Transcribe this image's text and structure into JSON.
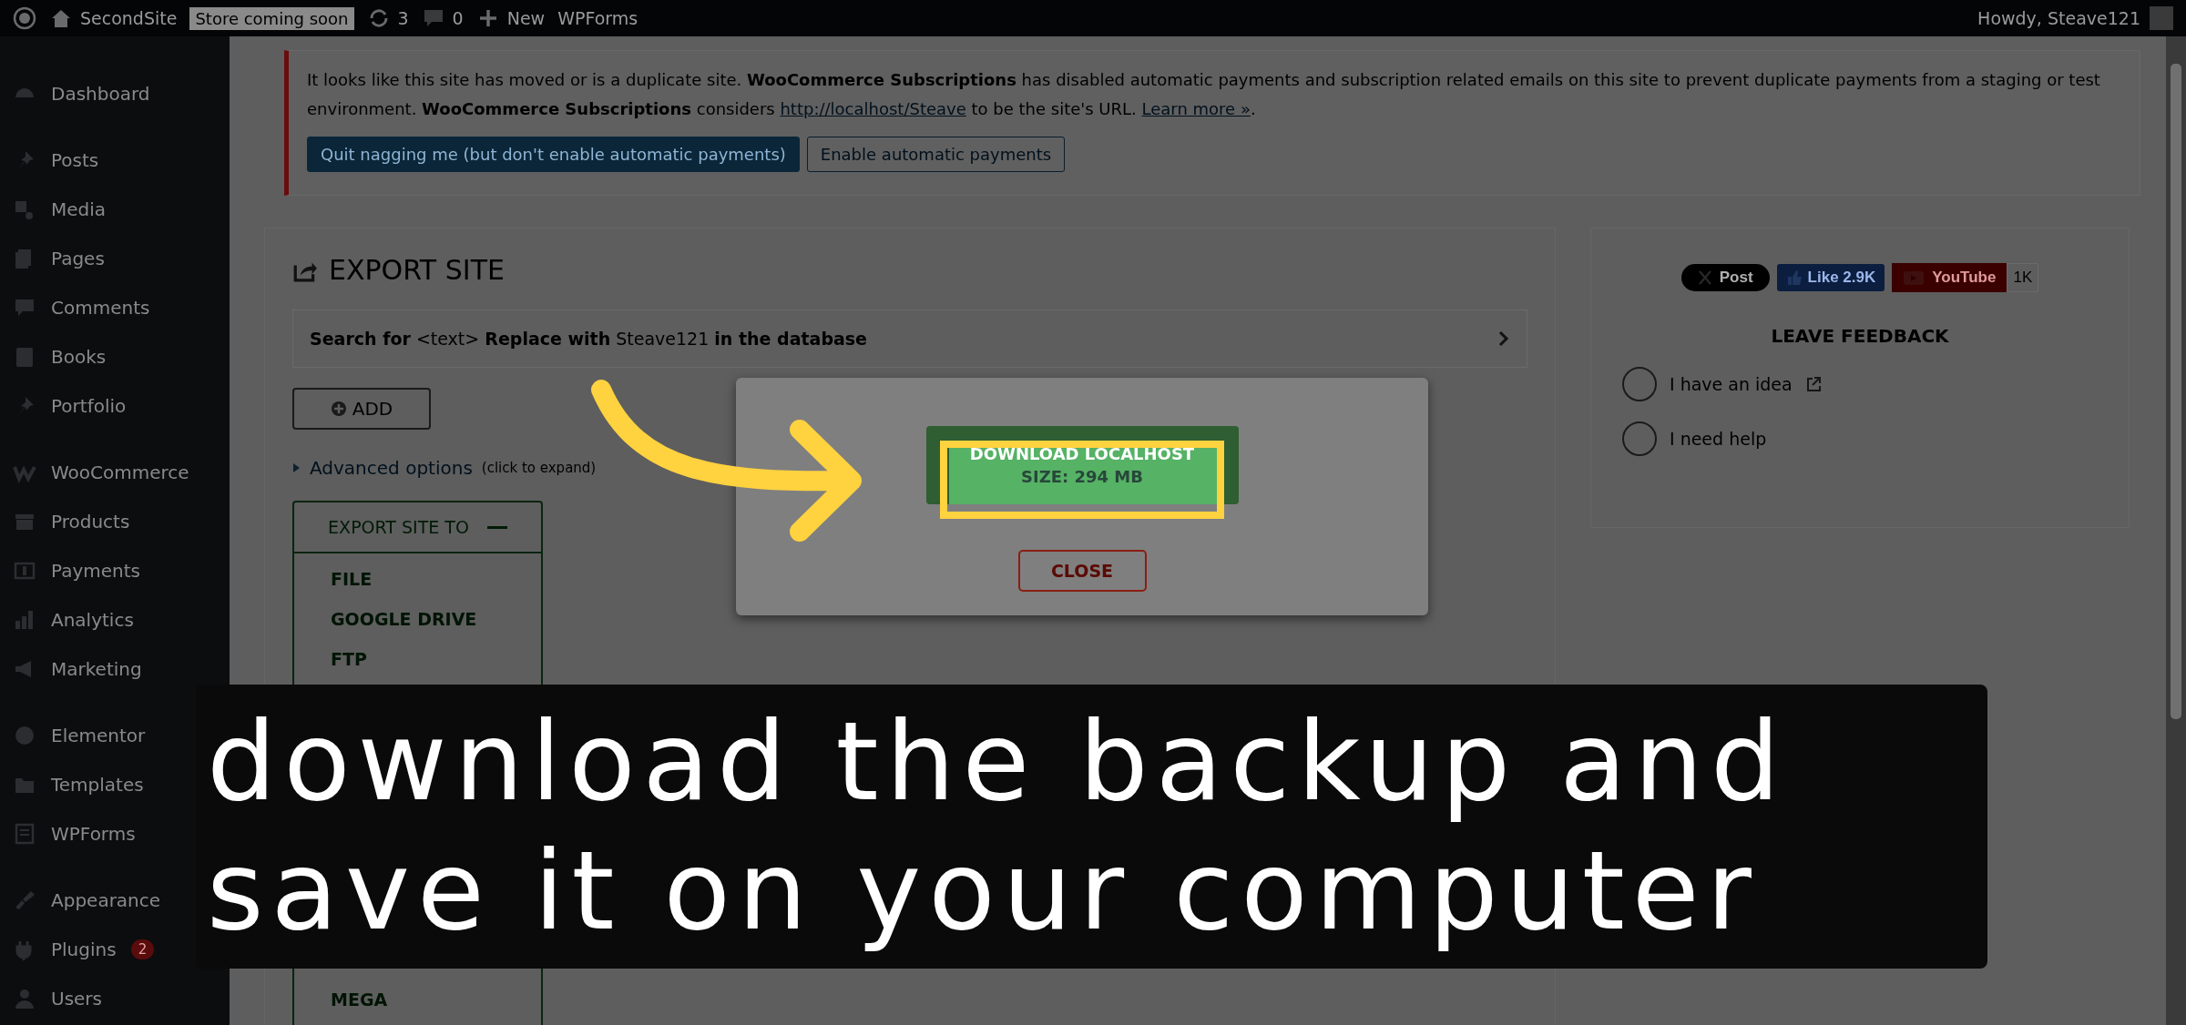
{
  "admin_bar": {
    "site_name": "SecondSite",
    "badge": "Store coming soon",
    "updates": "3",
    "comments": "0",
    "new": "New",
    "wpforms": "WPForms",
    "greeting": "Howdy, Steave121"
  },
  "sidebar": {
    "groups": [
      {
        "items": [
          {
            "label": "Dashboard"
          }
        ]
      },
      {
        "items": [
          {
            "label": "Posts"
          },
          {
            "label": "Media"
          },
          {
            "label": "Pages"
          },
          {
            "label": "Comments"
          },
          {
            "label": "Books"
          },
          {
            "label": "Portfolio"
          }
        ]
      },
      {
        "items": [
          {
            "label": "WooCommerce"
          },
          {
            "label": "Products"
          },
          {
            "label": "Payments"
          },
          {
            "label": "Analytics"
          },
          {
            "label": "Marketing"
          }
        ]
      },
      {
        "items": [
          {
            "label": "Elementor"
          },
          {
            "label": "Templates"
          },
          {
            "label": "WPForms"
          }
        ]
      },
      {
        "items": [
          {
            "label": "Appearance"
          },
          {
            "label": "Plugins",
            "badge": "2"
          },
          {
            "label": "Users"
          }
        ]
      }
    ]
  },
  "notice": {
    "text_start": "It looks like this site has moved or is a duplicate site. **WooCommerce Subscriptions** has disabled automatic payments and subscription related emails on this site to prevent duplicate payments from a staging or test environment. **WooCommerce Subscriptions** considers",
    "url": "http://localhost/Steave",
    "text_middle": "to be the site's URL.",
    "learn_more": "Learn more »",
    "text_end": ".",
    "buttons": [
      {
        "label": "Quit nagging me (but don't enable automatic payments)",
        "kind": "primary"
      },
      {
        "label": "Enable automatic payments",
        "kind": "secondary"
      }
    ]
  },
  "export": {
    "title": "EXPORT SITE",
    "search_replace": "**Search for** <text> **Replace with** Steave121 **in the database**",
    "add": "ADD",
    "advanced": "Advanced options",
    "advanced_hint": "(click to expand)",
    "targets": {
      "header": "EXPORT SITE TO",
      "expanded": true,
      "items_above": [
        "FILE",
        "GOOGLE DRIVE",
        "FTP"
      ],
      "items_below": [
        "MEGA"
      ]
    }
  },
  "side_panel": {
    "social": {
      "x": "Post",
      "like": "Like 2.9K",
      "youtube": "YouTube",
      "youtube_count": "1K"
    },
    "feedback_title": "LEAVE FEEDBACK",
    "options": [
      {
        "label": "I have an idea",
        "external": true,
        "selected": false
      },
      {
        "label": "I need help",
        "external": false,
        "selected": false
      }
    ]
  },
  "modal": {
    "download": "DOWNLOAD LOCALHOST",
    "size": "SIZE: 294 MB",
    "close": "CLOSE"
  },
  "caption": {
    "lines": [
      "download the backup and",
      "save it on your computer"
    ]
  }
}
